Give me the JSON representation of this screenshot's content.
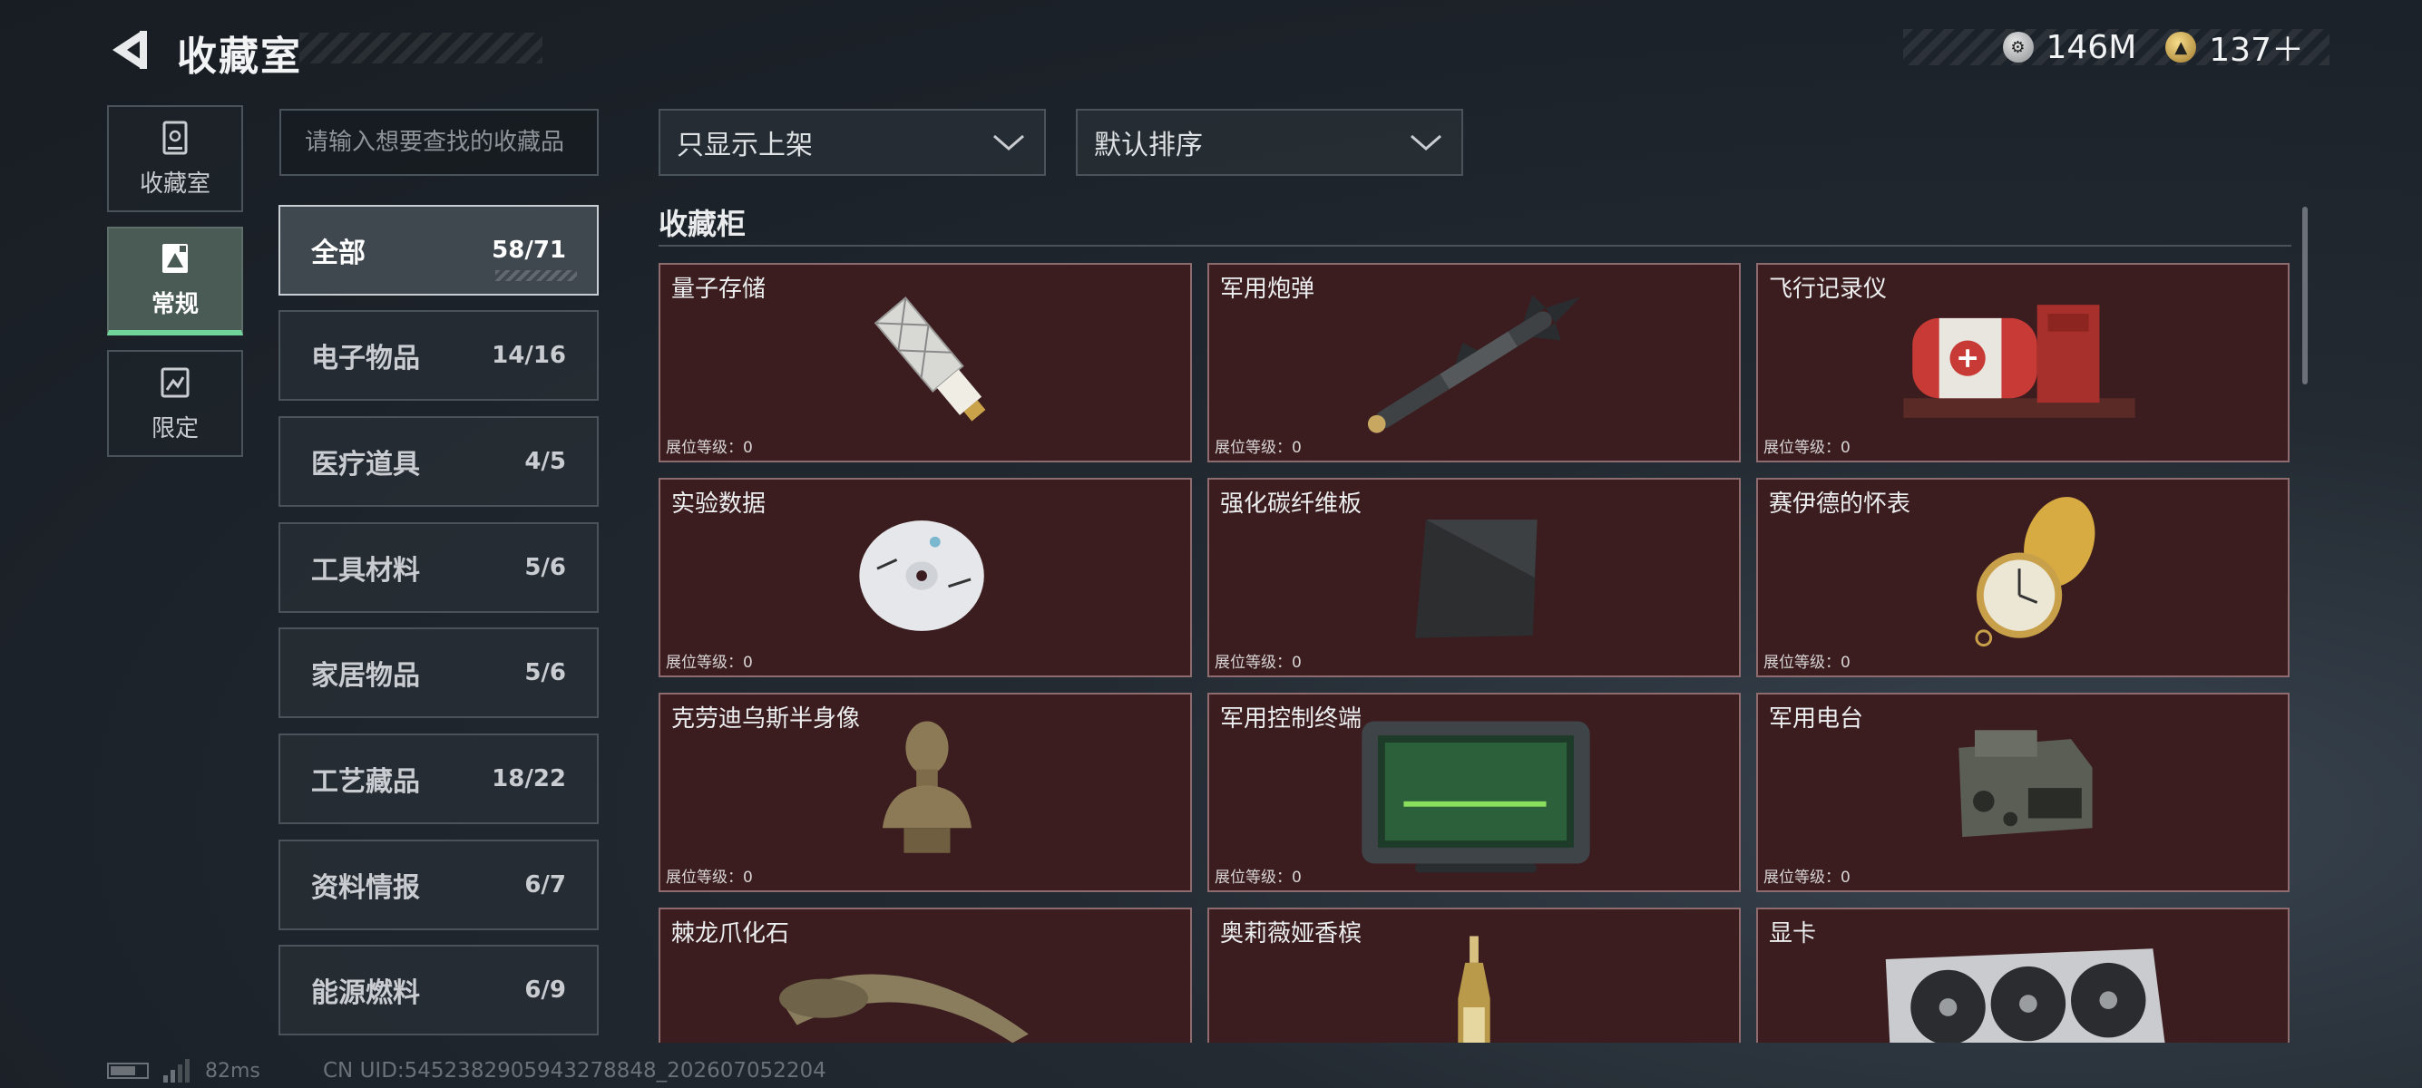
{
  "header": {
    "title": "收藏室",
    "currencies": [
      {
        "icon": "silver-coin-icon",
        "value": "146M"
      },
      {
        "icon": "gold-coin-icon",
        "value": "137＋"
      }
    ]
  },
  "nav_tabs": [
    {
      "label": "收藏室",
      "icon": "trophy-case-icon",
      "active": false
    },
    {
      "label": "常规",
      "icon": "portrait-frame-icon",
      "active": true
    },
    {
      "label": "限定",
      "icon": "limited-frame-icon",
      "active": false
    }
  ],
  "search": {
    "placeholder": "请输入想要查找的收藏品"
  },
  "categories": [
    {
      "name": "全部",
      "count": "58/71",
      "active": true
    },
    {
      "name": "电子物品",
      "count": "14/16"
    },
    {
      "name": "医疗道具",
      "count": "4/5"
    },
    {
      "name": "工具材料",
      "count": "5/6"
    },
    {
      "name": "家居物品",
      "count": "5/6"
    },
    {
      "name": "工艺藏品",
      "count": "18/22"
    },
    {
      "name": "资料情报",
      "count": "6/7"
    },
    {
      "name": "能源燃料",
      "count": "6/9"
    }
  ],
  "filters": {
    "shelf_filter": "只显示上架",
    "sort_order": "默认排序"
  },
  "section_title": "收藏柜",
  "items": [
    {
      "name": "量子存储",
      "level": "展位等级：0",
      "icon": "usb-drive-icon"
    },
    {
      "name": "军用炮弹",
      "level": "展位等级：0",
      "icon": "missile-icon"
    },
    {
      "name": "飞行记录仪",
      "level": "展位等级：0",
      "icon": "flight-recorder-icon"
    },
    {
      "name": "实验数据",
      "level": "展位等级：0",
      "icon": "disc-icon"
    },
    {
      "name": "强化碳纤维板",
      "level": "展位等级：0",
      "icon": "carbon-plate-icon"
    },
    {
      "name": "赛伊德的怀表",
      "level": "展位等级：0",
      "icon": "pocket-watch-icon"
    },
    {
      "name": "克劳迪乌斯半身像",
      "level": "展位等级：0",
      "icon": "bust-icon"
    },
    {
      "name": "军用控制终端",
      "level": "展位等级：0",
      "icon": "terminal-icon"
    },
    {
      "name": "军用电台",
      "level": "展位等级：0",
      "icon": "radio-icon"
    },
    {
      "name": "棘龙爪化石",
      "level": "",
      "icon": "claw-fossil-icon"
    },
    {
      "name": "奥莉薇娅香槟",
      "level": "",
      "icon": "champagne-icon"
    },
    {
      "name": "显卡",
      "level": "",
      "icon": "graphics-card-icon"
    }
  ],
  "footer": {
    "ping": "82ms",
    "uid": "CN UID:5452382905943278848_202607052204"
  }
}
